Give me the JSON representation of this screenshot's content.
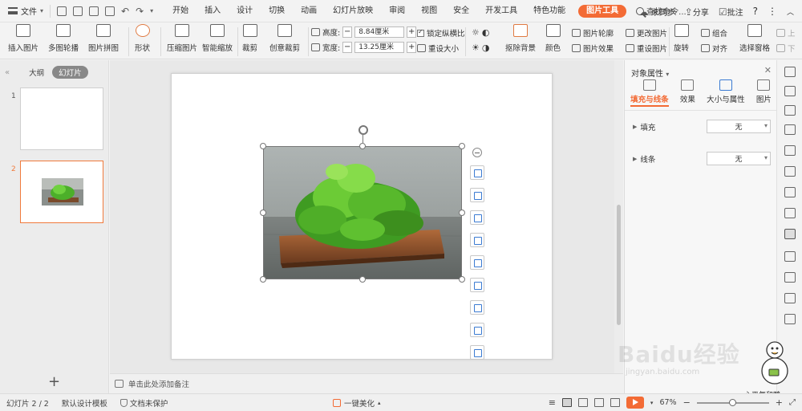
{
  "menubar": {
    "file_label": "文件",
    "tabs": [
      "开始",
      "插入",
      "设计",
      "切换",
      "动画",
      "幻灯片放映",
      "审阅",
      "视图",
      "安全",
      "开发工具",
      "特色功能",
      "图片工具"
    ],
    "active_tab": "图片工具",
    "search_label": "查找命令...",
    "sync_label": "未同步",
    "share_label": "分享",
    "comment_label": "批注",
    "help_label": "?"
  },
  "ribbon": {
    "insert_picture": "插入图片",
    "multi_outline": "多图轮播",
    "picture_collage": "图片拼图",
    "shape": "形状",
    "compress": "压缩图片",
    "smart_scale": "智能缩放",
    "crop": "裁剪",
    "creative_crop": "创意裁剪",
    "height_label": "高度:",
    "height_value": "8.84厘米",
    "width_label": "宽度:",
    "width_value": "13.25厘米",
    "lock_ratio": "锁定纵横比",
    "reset_size": "重设大小",
    "remove_bg": "抠除背景",
    "color": "颜色",
    "picture_outline": "图片轮廓",
    "picture_effect": "图片效果",
    "change_picture": "更改图片",
    "reset_picture": "重设图片",
    "rotate": "旋转",
    "group": "组合",
    "align": "对齐",
    "selection_pane": "选择窗格",
    "up": "上",
    "down": "下"
  },
  "left_panel": {
    "tab_outline": "大纲",
    "tab_slides": "幻灯片",
    "slides": [
      {
        "number": "1"
      },
      {
        "number": "2"
      }
    ]
  },
  "notes": {
    "placeholder": "单击此处添加备注"
  },
  "right_panel": {
    "title": "对象属性",
    "tabs": [
      "填充与线条",
      "效果",
      "大小与属性",
      "图片"
    ],
    "active_tab": "填充与线条",
    "fill_label": "填充",
    "fill_value": "无",
    "line_label": "线条",
    "line_value": "无"
  },
  "statusbar": {
    "slide_info": "幻灯片 2 / 2",
    "template": "默认设计模板",
    "doc_protect": "文档未保护",
    "beautify": "一键美化",
    "zoom": "67%"
  },
  "watermark": {
    "brand": "Baidu经验",
    "url": "jingyan.baidu.com",
    "handwriting": "心平气和鸭"
  },
  "colors": {
    "accent": "#f36b35",
    "blue_icon": "#3b7bd2"
  }
}
